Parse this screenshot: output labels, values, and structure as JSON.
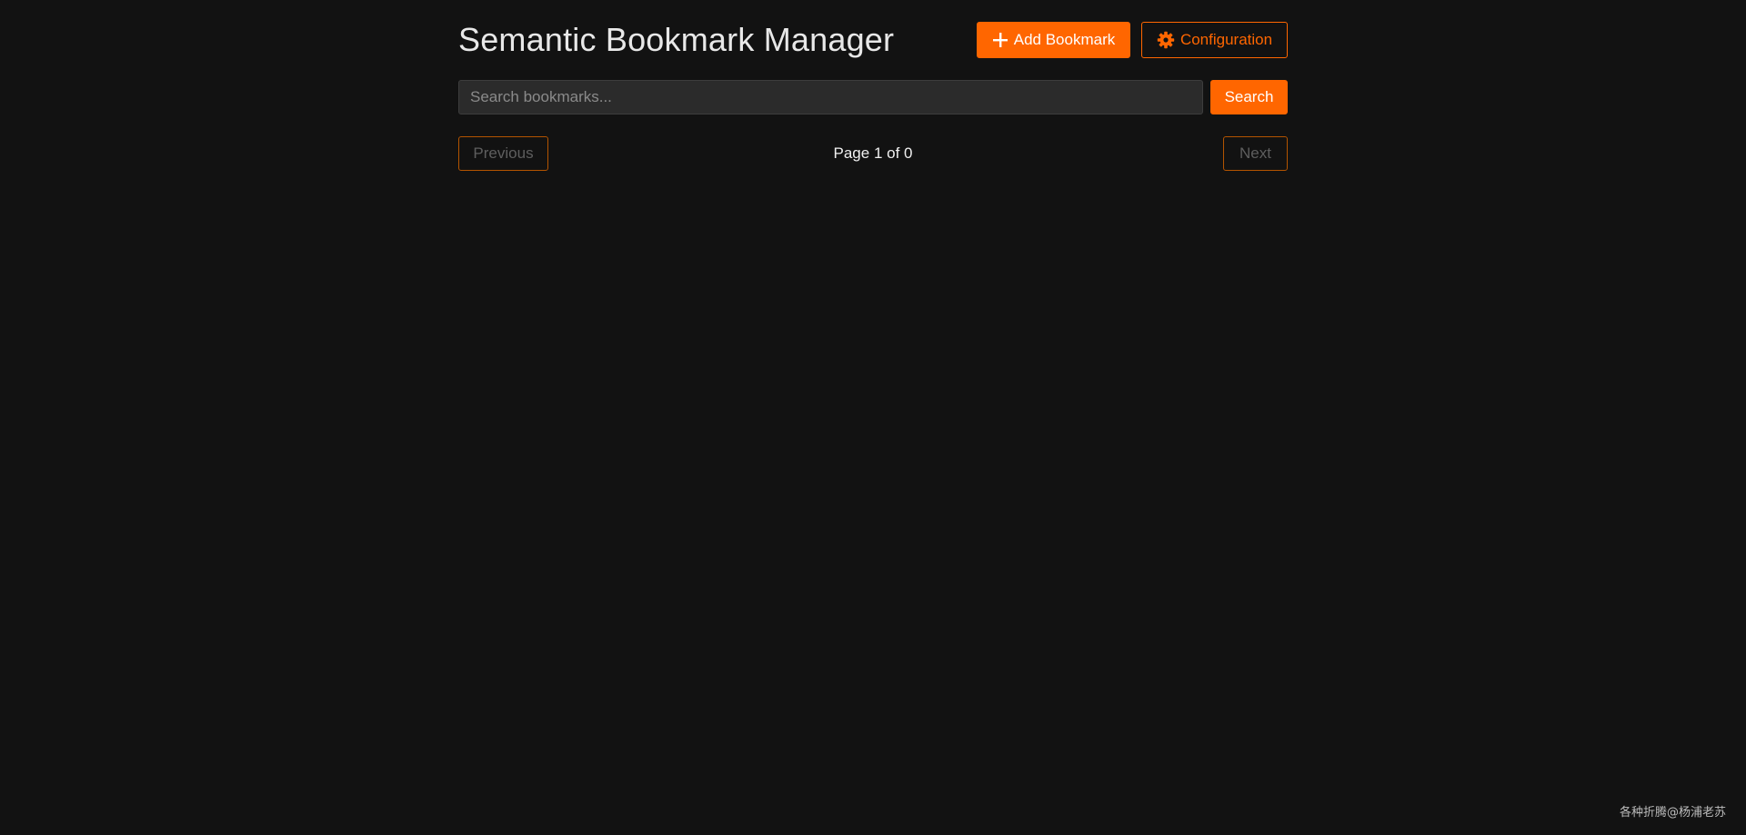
{
  "header": {
    "title": "Semantic Bookmark Manager",
    "add_label": "Add Bookmark",
    "config_label": "Configuration"
  },
  "icons": {
    "add": "plus-icon",
    "config": "gear-icon"
  },
  "search": {
    "value": "",
    "placeholder": "Search bookmarks...",
    "button_label": "Search"
  },
  "pagination": {
    "prev_label": "Previous",
    "next_label": "Next",
    "page_info": "Page 1 of 0",
    "current_page": 1,
    "total_pages": 0
  },
  "watermark": "各种折腾@杨浦老苏",
  "colors": {
    "accent": "#ff6600",
    "background": "#121212"
  }
}
